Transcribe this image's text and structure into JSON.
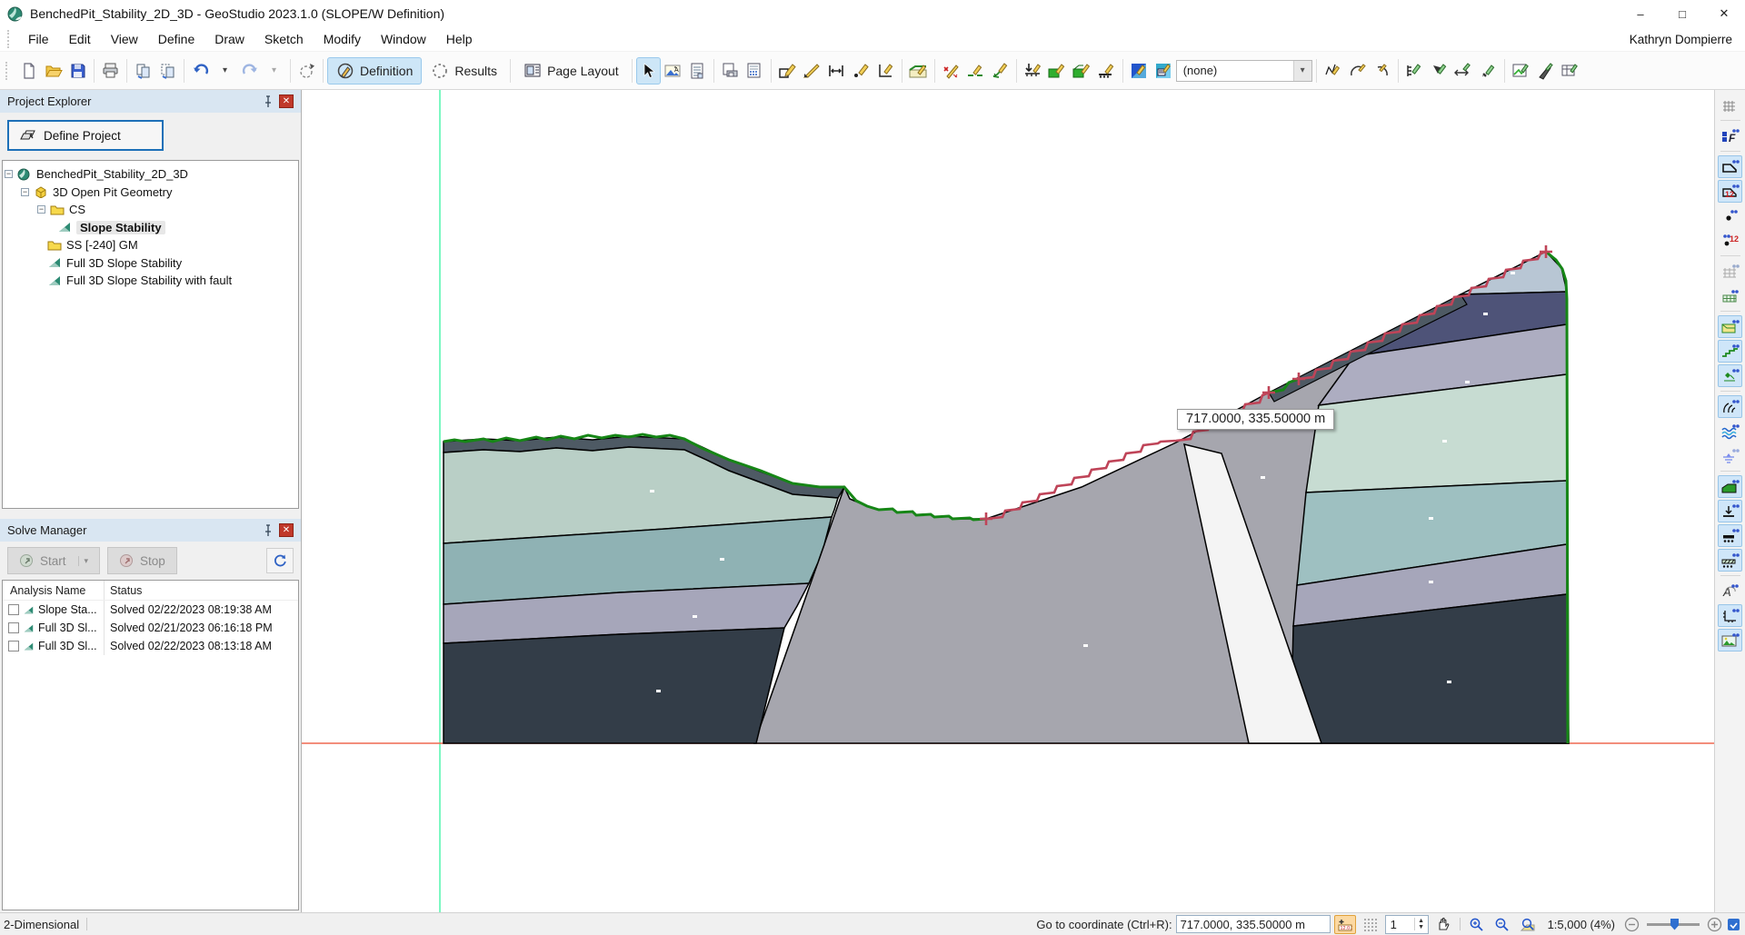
{
  "window": {
    "title": "BenchedPit_Stability_2D_3D - GeoStudio 2023.1.0 (SLOPE/W Definition)",
    "minimize": "–",
    "maximize": "□",
    "close": "✕"
  },
  "menu": {
    "items": [
      "File",
      "Edit",
      "View",
      "Define",
      "Draw",
      "Sketch",
      "Modify",
      "Window",
      "Help"
    ],
    "user": "Kathryn Dompierre"
  },
  "toolbar": {
    "definition_label": "Definition",
    "results_label": "Results",
    "page_layout_label": "Page Layout",
    "analysis_filter_value": "(none)"
  },
  "project_explorer": {
    "title": "Project Explorer",
    "define_project_label": "Define Project",
    "tree": [
      {
        "label": "BenchedPit_Stability_2D_3D"
      },
      {
        "label": "3D Open Pit Geometry"
      },
      {
        "label": "CS"
      },
      {
        "label": "Slope Stability"
      },
      {
        "label": "SS [-240] GM"
      },
      {
        "label": "Full 3D Slope Stability"
      },
      {
        "label": "Full 3D Slope Stability with fault"
      }
    ]
  },
  "solve_manager": {
    "title": "Solve Manager",
    "start_label": "Start",
    "stop_label": "Stop",
    "col_name": "Analysis Name",
    "col_status": "Status",
    "rows": [
      {
        "name": "Slope Sta...",
        "status": "Solved 02/22/2023 08:19:38 AM"
      },
      {
        "name": "Full 3D Sl...",
        "status": "Solved 02/21/2023 06:16:18 PM"
      },
      {
        "name": "Full 3D Sl...",
        "status": "Solved 02/22/2023 08:13:18 AM"
      }
    ]
  },
  "canvas": {
    "tooltip_text": "717.0000, 335.50000 m"
  },
  "status_bar": {
    "dimension_label": "2-Dimensional",
    "goto_label": "Go to coordinate (Ctrl+R):",
    "coordinate_value": "717.0000, 335.50000 m",
    "page_value": "1",
    "zoom_label": "1:5,000 (4%)"
  },
  "colors": {
    "pale_green": "#b9cfc6",
    "pale_green_light": "#c7dcd2",
    "teal": "#8fb2b4",
    "teal_light": "#9ec0c1",
    "purple_gray": "#a6a6ba",
    "purple_gray_light": "#adadc1",
    "dark_slate": "#333d48",
    "dark_top": "#4e5a64",
    "gray_rock": "#a6a6ae",
    "steel_blue": "#b8c6d4",
    "dark_blue": "#4e5378",
    "fault_white": "#f4f4f4",
    "surface_green": "#168616",
    "bench_red": "#bf4458",
    "axis_vertical": "#7df8c2",
    "axis_horizontal": "#ef6950",
    "accent_blue": "#1d70b8",
    "selected_bg": "#cde6f7"
  }
}
